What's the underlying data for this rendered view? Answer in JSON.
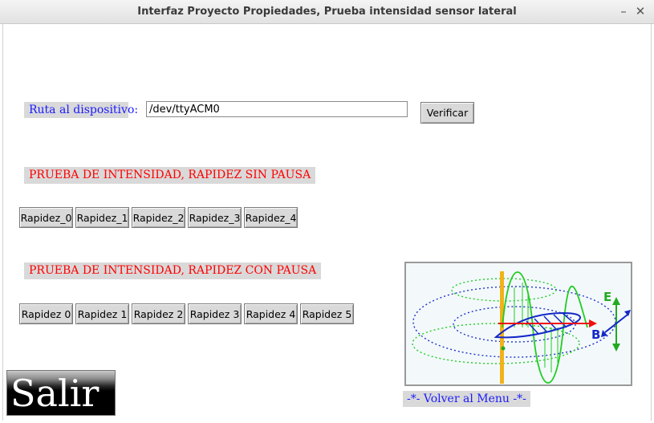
{
  "window": {
    "title": "Interfaz Proyecto Propiedades, Prueba intensidad sensor lateral",
    "minimize_glyph": "–",
    "close_glyph": "✕"
  },
  "device": {
    "label": "Ruta al dispositivo:",
    "value": "/dev/ttyACM0",
    "verify_label": "Verificar"
  },
  "section_no_pause": {
    "heading": "PRUEBA DE INTENSIDAD, RAPIDEZ SIN PAUSA",
    "buttons": [
      "Rapidez_0",
      "Rapidez_1",
      "Rapidez_2",
      "Rapidez_3",
      "Rapidez_4"
    ]
  },
  "section_pause": {
    "heading": "PRUEBA DE INTENSIDAD,  RAPIDEZ CON PAUSA",
    "buttons": [
      "Rapidez 0",
      "Rapidez 1",
      "Rapidez 2",
      "Rapidez 3",
      "Rapidez 4",
      "Rapidez 5"
    ]
  },
  "image": {
    "e_label": "E",
    "b_label": "B"
  },
  "exit_label": "Salir",
  "back_label": "-*- Volver al Menu -*-"
}
